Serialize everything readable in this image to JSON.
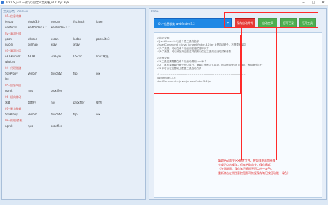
{
  "window": {
    "title": "TOOLS_GUI    一款可以自定义工具箱_v1.0    by：kyk",
    "minimize": "─",
    "maximize": "□",
    "close": "✕"
  },
  "left_panel": {
    "title": "工具分类: ToolsGui",
    "groups": [
      {
        "category": "01--信息收集",
        "tools": [
          "0nsub",
          "ehole3.0",
          "enscan",
          "fscjhash",
          "layer",
          "oneforall",
          "webfinder-3.2",
          "webfinder-3.2"
        ]
      },
      {
        "category": "02--漏洞扫描",
        "tools": [
          "goon",
          "k8scan",
          "kscan",
          "ladon",
          "pocsuite3",
          "nuclei",
          "sqlmap",
          "xray",
          "xray"
        ]
      },
      {
        "category": "03--漏洞利用",
        "tools": [
          "APT-Hunter",
          "ARTP",
          "FireFylo",
          "GScan",
          "linux取证",
          "whoths"
        ]
      },
      {
        "category": "04--代理隧道",
        "tools": [
          "SCFProxy",
          "Venom",
          "dnscat2",
          "frp",
          "iox",
          "lcx"
        ]
      },
      {
        "category": "05--应急响应",
        "tools": [
          "ngrok",
          "nps",
          "proxifier"
        ]
      },
      {
        "category": "06--横向移动",
        "tools": [
          "冰蝎",
          "哥斯拉",
          "nps",
          "proxifier",
          "蚁剑"
        ]
      },
      {
        "category": "07--暴力破解",
        "tools": [
          "SCFProxy",
          "Venom",
          "dnscat2",
          "frp",
          "iox"
        ]
      },
      {
        "category": "08--维权/提权",
        "tools": [
          "ngrok",
          "nps",
          "proxifier"
        ]
      }
    ]
  },
  "right_panel": {
    "title": "Rome",
    "combo_value": "01--信息收集  webfinder-3.2",
    "buttons": {
      "save": "保存启动命令",
      "launch": "启动工具",
      "open_dir": "打开目录",
      "open_tool": "打开工具"
    },
    "editor_lines": [
      "#描述说明：",
      "#[webfinder-3.2]    这个是工具的名字",
      "#startCommand = java -jar webfinder-3.2.jar  #是启动命令，不需要就留空",
      "#为了美观，可以在命令后面用空格把注释对齐",
      "#为了美观，可以添加对应的注释说明以保证工具的启动方式和参数",
      "#示例说明：",
      "#1.工具如果需要在命令行启动请用cmd命令",
      "#2.工具如果需要在命令行中执行，需要以多种方式启动，可以是python go.py，等待命令执行",
      "#3.你可以在此基础上配置工具启动方式",
      "# =========================================",
      "[webfinder-3.2]",
      "startCommand = java -jar webfinder-3.2.jar"
    ]
  },
  "annotation": {
    "lines": [
      "填取启动命令>>配置文件，按照样例添加参数",
      "完成后点击保存，保存启动命令，保存格式",
      "（在此期间，保存笔记随时不可点击一灰色，",
      "重新点击左侧任意按钮即可恢复保存笔记按钮功能一绿色）"
    ]
  },
  "colors": {
    "background": "#dce8f5",
    "accent_blue": "#1e88e5",
    "button_green": "#4caf50",
    "button_red": "#e53935",
    "category_red": "#d9534f",
    "annotation_red": "#ff2a2a"
  }
}
